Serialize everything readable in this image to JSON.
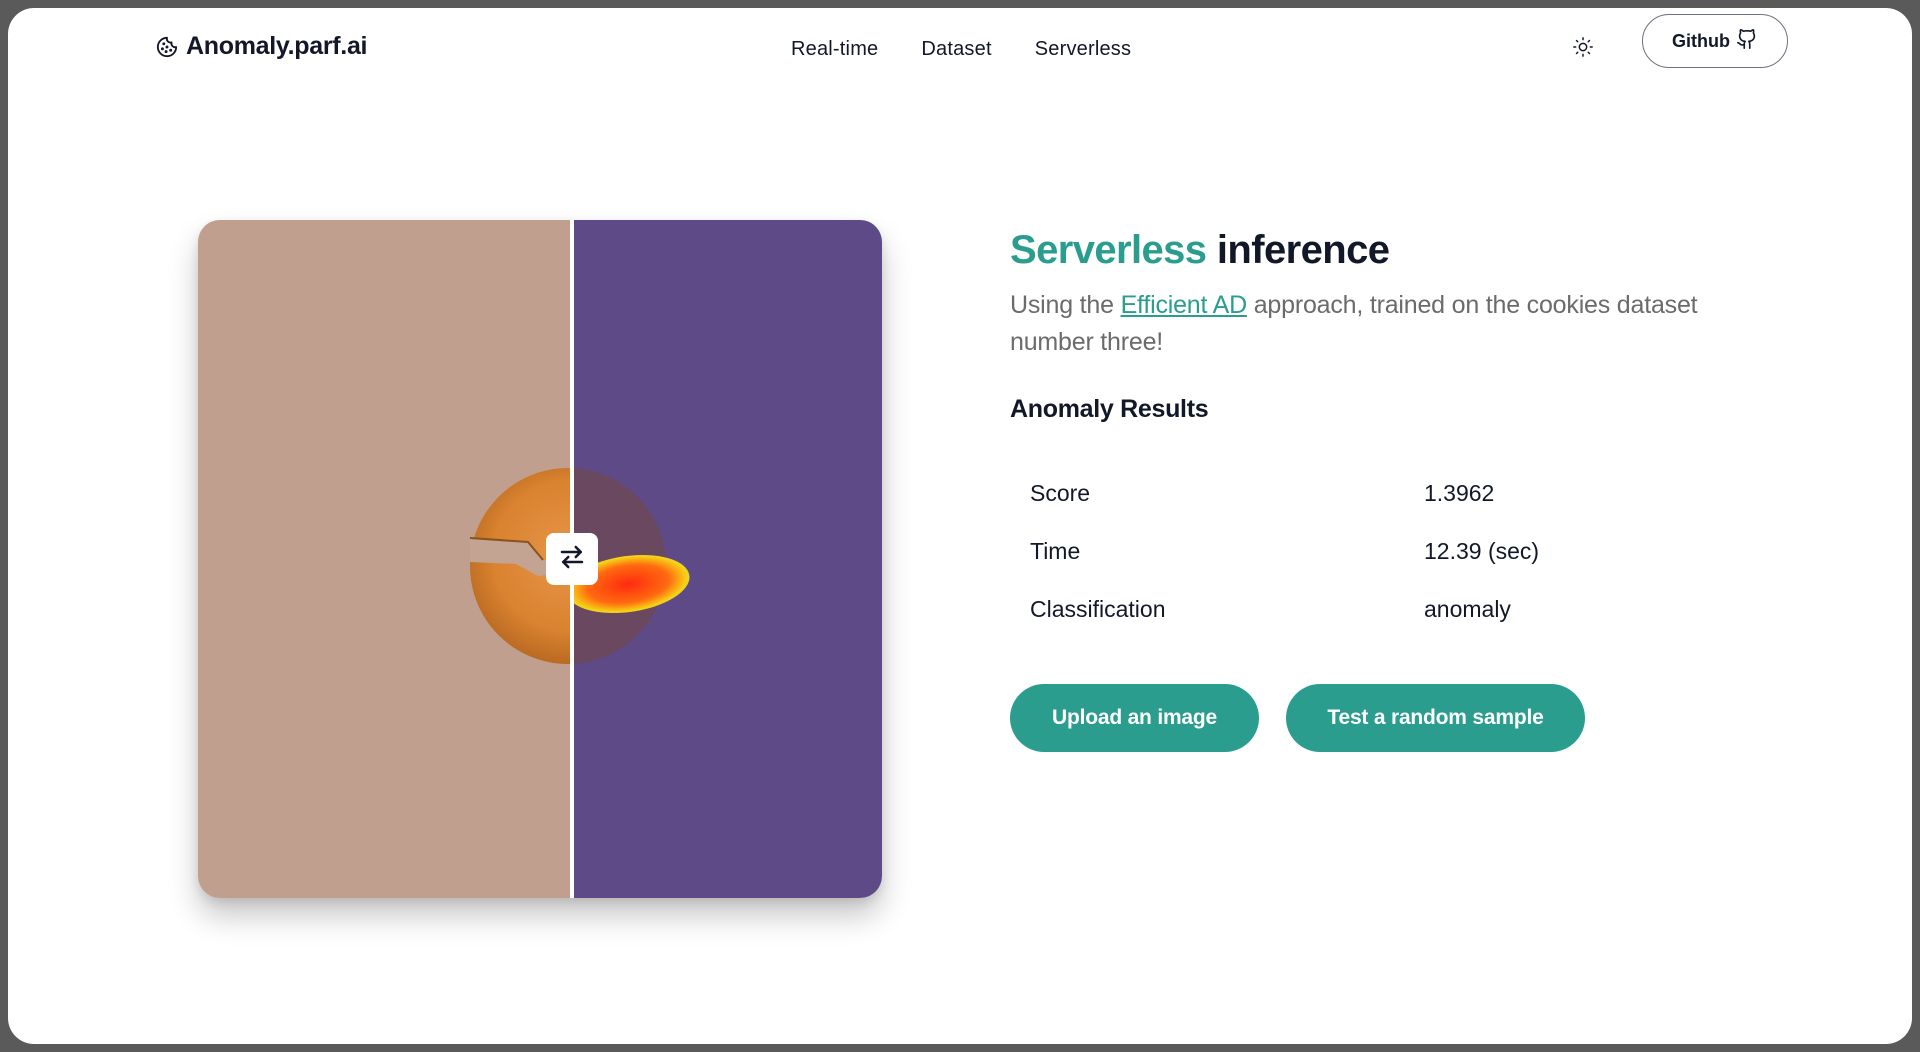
{
  "brand": {
    "name": "Anomaly.parf.ai",
    "icon": "cookie-icon"
  },
  "nav": {
    "items": [
      "Real-time",
      "Dataset",
      "Serverless"
    ]
  },
  "header": {
    "theme_icon": "sun-icon",
    "github_label": "Github",
    "github_icon": "github-icon"
  },
  "hero": {
    "title_accent": "Serverless",
    "title_rest": "inference",
    "subtitle_before": "Using the",
    "subtitle_link": "Efficient AD",
    "subtitle_after": "approach, trained on the cookies dataset number three!"
  },
  "results": {
    "title": "Anomaly Results",
    "rows": [
      {
        "label": "Score",
        "value": "1.3962"
      },
      {
        "label": "Time",
        "value": "12.39 (sec)"
      },
      {
        "label": "Classification",
        "value": "anomaly"
      }
    ]
  },
  "actions": {
    "upload_label": "Upload an image",
    "random_label": "Test a random sample"
  },
  "compare": {
    "handle_icon": "swap-arrows-icon"
  },
  "colors": {
    "accent": "#2a9d8f",
    "heatmap_bg": "#5e4a87",
    "original_bg": "#c0a090"
  }
}
